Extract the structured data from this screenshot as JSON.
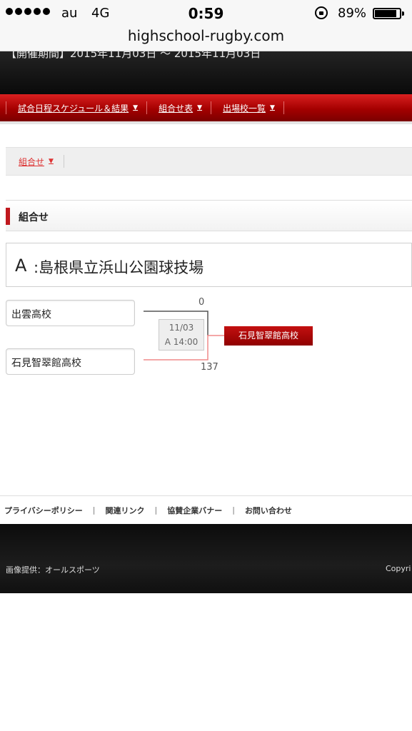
{
  "status_bar": {
    "carrier": "au",
    "network": "4G",
    "time": "0:59",
    "battery": "89%",
    "battery_level": 0.89,
    "signal_bars": 5
  },
  "browser": {
    "url": "highschool-rugby.com"
  },
  "header": {
    "period_text": "【開催期間】2015年11月03日 ～ 2015年11月03日"
  },
  "nav": {
    "items": [
      {
        "label": "試合日程スケジュール＆結果"
      },
      {
        "label": "組合せ表"
      },
      {
        "label": "出場校一覧"
      }
    ]
  },
  "subnav": {
    "label": "組合せ"
  },
  "section": {
    "title": "組合せ"
  },
  "venue": {
    "letter": "A",
    "name": ":島根県立浜山公園球技場"
  },
  "match": {
    "team1": "出雲高校",
    "team2": "石見智翠館高校",
    "score1": "0",
    "score2": "137",
    "date": "11/03",
    "slot": "A 14:00",
    "winner": "石見智翠館高校",
    "colors": {
      "winner_line": "#f08a8a",
      "loser_line": "#555555",
      "winner_box": "#a80a0a"
    }
  },
  "footer": {
    "links": [
      "プライバシーポリシー",
      "関連リンク",
      "協賛企業バナー",
      "お問い合わせ"
    ],
    "credit": "画像提供：オールスポーツ",
    "copyright": "Copyri"
  }
}
